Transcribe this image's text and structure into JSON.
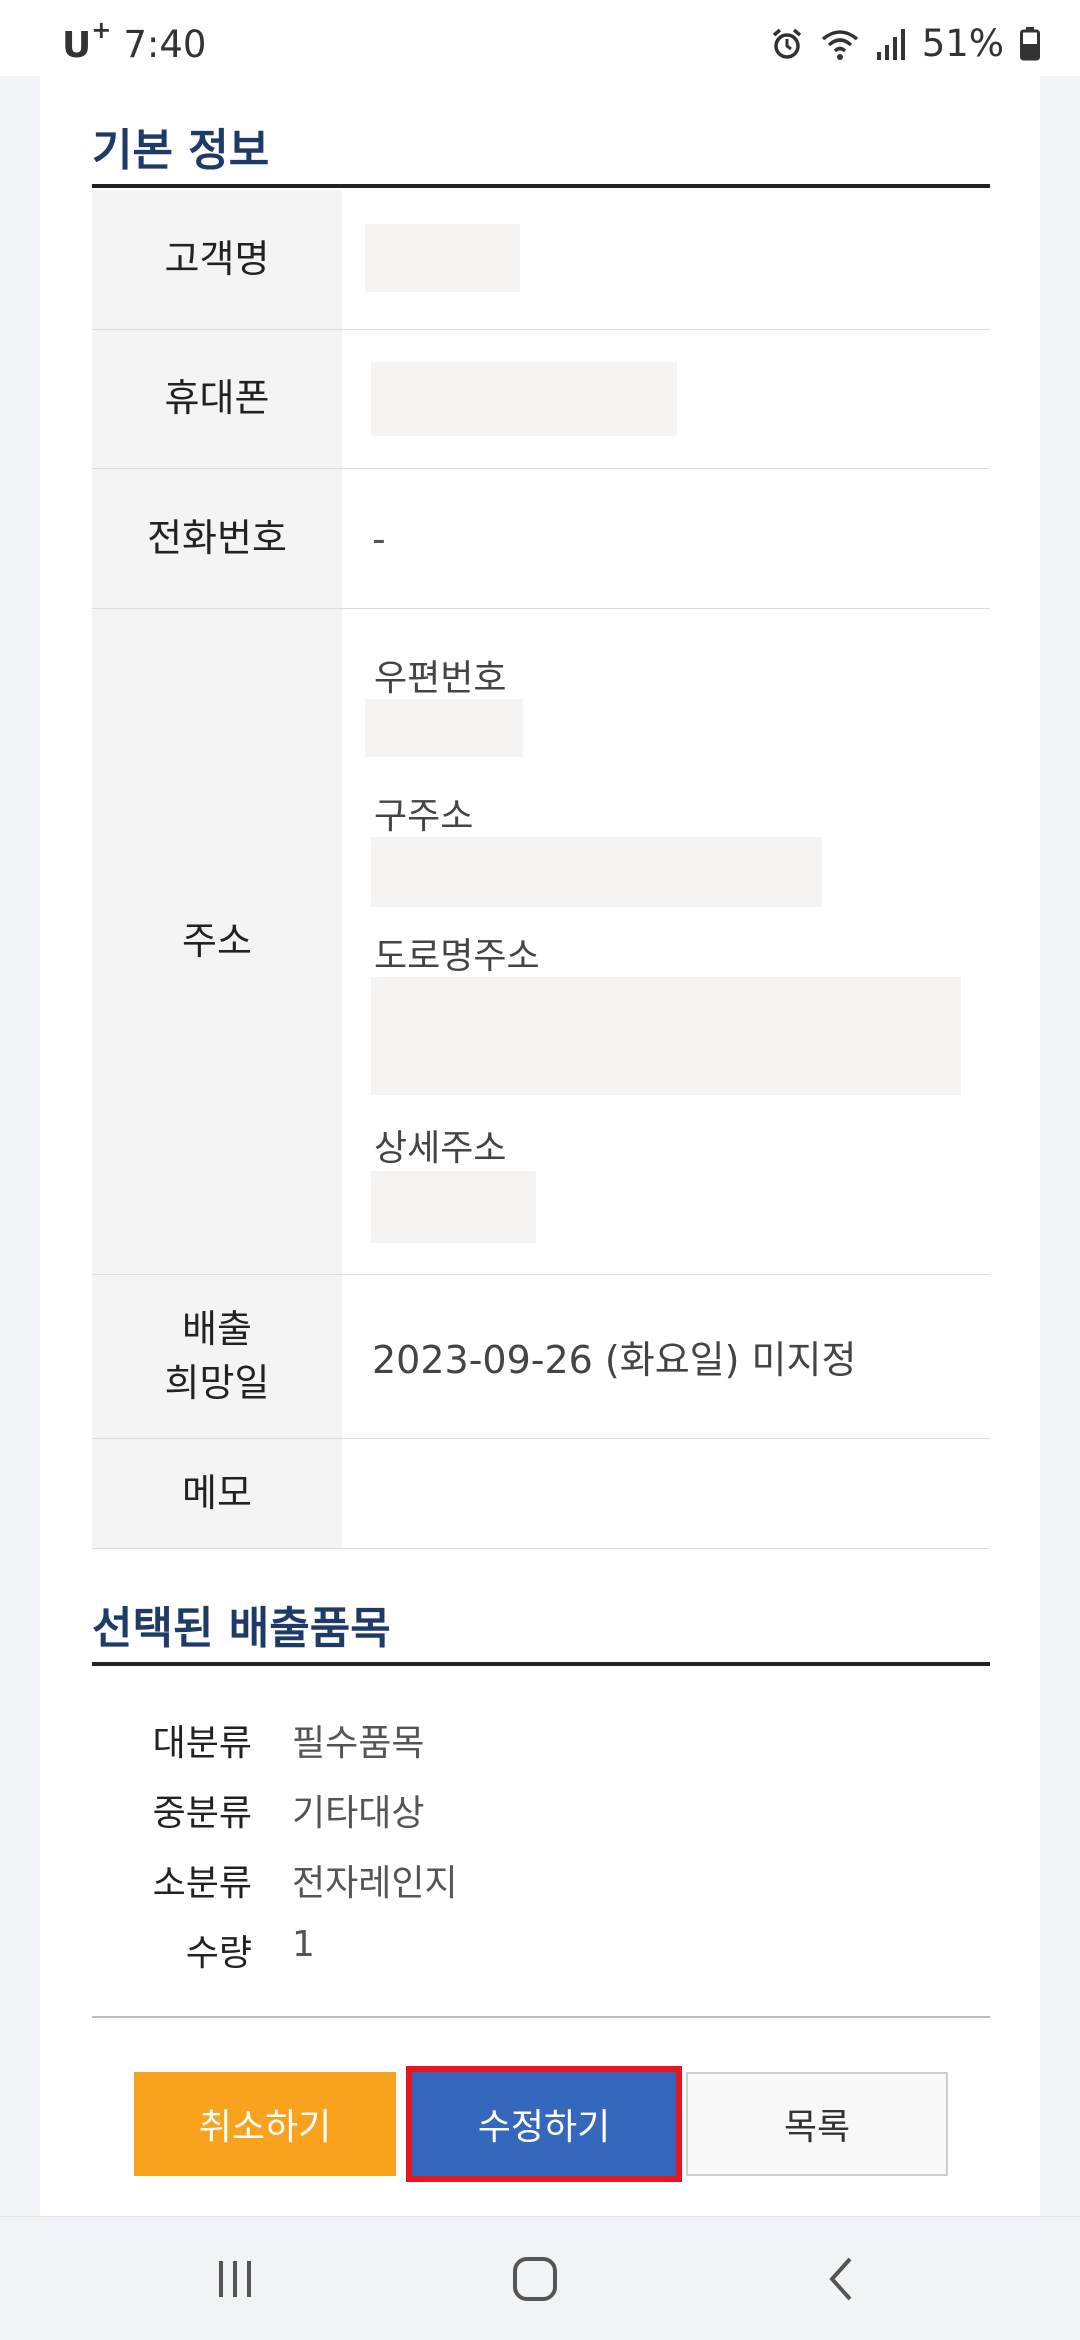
{
  "status_bar": {
    "carrier": "U",
    "carrier_sup": "+",
    "time": "7:40",
    "battery": "51%"
  },
  "basic_info": {
    "title": "기본 정보",
    "rows": {
      "customer_name": "고객명",
      "mobile": "휴대폰",
      "phone": "전화번호",
      "phone_value": "-",
      "address": "주소",
      "desired_date_line1": "배출",
      "desired_date_line2": "희망일",
      "desired_date_value": "2023-09-26 (화요일) 미지정",
      "memo": "메모"
    },
    "address_labels": {
      "postcode": "우편번호",
      "old_address": "구주소",
      "road_address": "도로명주소",
      "detail_address": "상세주소"
    }
  },
  "selected_items": {
    "title": "선택된 배출품목",
    "rows": [
      {
        "key": "대분류",
        "value": "필수품목"
      },
      {
        "key": "중분류",
        "value": "기타대상"
      },
      {
        "key": "소분류",
        "value": "전자레인지"
      },
      {
        "key": "수량",
        "value": "1"
      }
    ]
  },
  "buttons": {
    "cancel": "취소하기",
    "edit": "수정하기",
    "list": "목록"
  },
  "colors": {
    "title": "#1e3a66",
    "cancel_button": "#f9a21e",
    "edit_button": "#3567bd",
    "highlight_outline": "#e8141e"
  },
  "icons": {
    "status": [
      "alarm-icon",
      "wifi-icon",
      "signal-icon",
      "battery-icon"
    ],
    "nav": [
      "recent-apps-icon",
      "home-icon",
      "back-icon"
    ]
  }
}
